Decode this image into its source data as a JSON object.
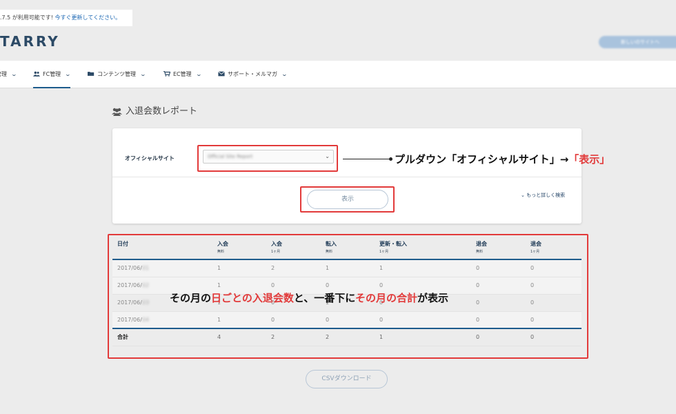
{
  "notice": {
    "text": ".7.5 が利用可能です! ",
    "link": "今すぐ更新してください。"
  },
  "header": {
    "logo": "TARRY",
    "button": "新しいのサイトへ"
  },
  "nav": [
    {
      "label": "管理",
      "icon": "none"
    },
    {
      "label": "FC管理",
      "icon": "users-icon"
    },
    {
      "label": "コンテンツ管理",
      "icon": "folder-icon"
    },
    {
      "label": "EC管理",
      "icon": "cart-icon"
    },
    {
      "label": "サポート・メルマガ",
      "icon": "mail-icon"
    }
  ],
  "page": {
    "title": "入退会数レポート"
  },
  "search": {
    "site_label": "オフィシャルサイト",
    "site_value": "Official Site Report",
    "show_button": "表示",
    "more_link": "もっと詳しく検索"
  },
  "table": {
    "headers": [
      {
        "label": "日付",
        "sub": ""
      },
      {
        "label": "入会",
        "sub": "無料"
      },
      {
        "label": "入会",
        "sub": "1ヶ月"
      },
      {
        "label": "転入",
        "sub": "無料"
      },
      {
        "label": "更新・転入",
        "sub": "1ヶ月"
      },
      {
        "label": "退会",
        "sub": "無料"
      },
      {
        "label": "退会",
        "sub": "1ヶ月"
      }
    ],
    "rows": [
      {
        "date": "2017/06/",
        "date_blur": "01",
        "v": [
          "1",
          "2",
          "1",
          "1",
          "0",
          "0"
        ]
      },
      {
        "date": "2017/06/",
        "date_blur": "02",
        "v": [
          "1",
          "0",
          "0",
          "0",
          "0",
          "0"
        ]
      },
      {
        "date": "2017/06/",
        "date_blur": "03",
        "v": [
          "1",
          "0",
          "1",
          "0",
          "0",
          "0"
        ]
      },
      {
        "date": "2017/06/",
        "date_blur": "04",
        "v": [
          "1",
          "0",
          "0",
          "0",
          "0",
          "0"
        ]
      }
    ],
    "total": {
      "label": "合計",
      "v": [
        "4",
        "2",
        "2",
        "1",
        "0",
        "0"
      ]
    }
  },
  "csv_button": "CSVダウンロード",
  "annotations": {
    "top": {
      "black": "プルダウン「オフィシャルサイト」→",
      "red": "「表示」"
    },
    "middle": {
      "p1": "その月の",
      "r1": "日ごとの入退会数",
      "p2": "と、一番下に",
      "r2": "その月の合計",
      "p3": "が表示"
    },
    "highlight_color": "#e23a3a"
  }
}
